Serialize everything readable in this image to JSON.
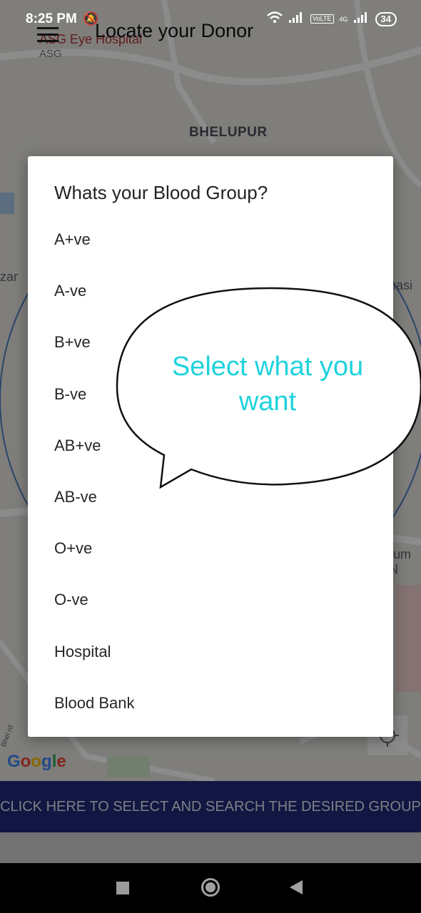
{
  "status_bar": {
    "time": "8:25 PM",
    "battery": "34",
    "network_badge": "4G"
  },
  "app": {
    "title": "Locate your Donor"
  },
  "map": {
    "poi_name": "ASG Eye Hospital",
    "poi_sub": "ASG",
    "area_label": "BHELUPUR",
    "fragment_left": "zar",
    "fragment_right": "nasi",
    "fragment_right2": "rum N",
    "fragment_road": "Bhel rd",
    "google_logo": "Google"
  },
  "dialog": {
    "title": "Whats your Blood Group?",
    "options": [
      "A+ve",
      "A-ve",
      "B+ve",
      "B-ve",
      "AB+ve",
      "AB-ve",
      "O+ve",
      "O-ve",
      "Hospital",
      "Blood Bank"
    ]
  },
  "overlay": {
    "bubble_line1": "Select what you",
    "bubble_line2": "want"
  },
  "search_button": {
    "label": "CLICK HERE TO SELECT AND SEARCH THE DESIRED GROUP"
  },
  "colors": {
    "accent_text": "#1fd3dc",
    "search_bar": "#1f2a78"
  }
}
